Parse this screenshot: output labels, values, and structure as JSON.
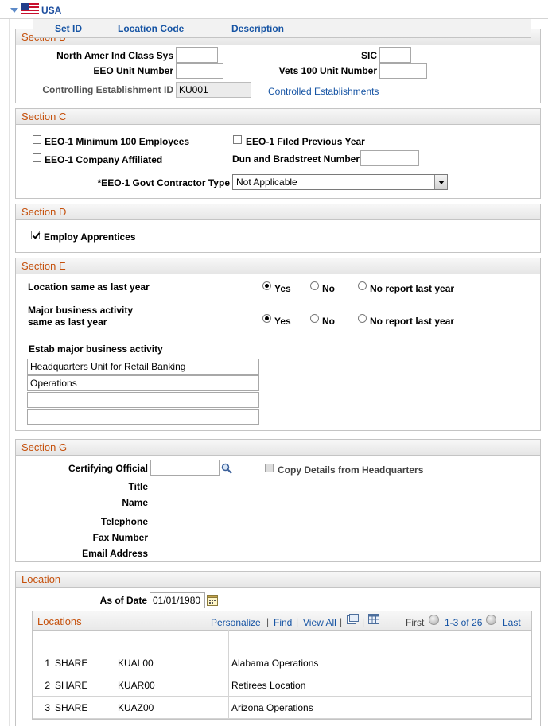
{
  "header": {
    "title": "USA"
  },
  "section_b": {
    "title": "Section B",
    "naics_label": "North Amer Ind Class Sys",
    "naics_value": "",
    "sic_label": "SIC",
    "sic_value": "",
    "eeo_unit_label": "EEO Unit Number",
    "eeo_unit_value": "",
    "vets_label": "Vets 100 Unit Number",
    "vets_value": "",
    "ctrl_label": "Controlling Establishment ID",
    "ctrl_value": "KU001",
    "ctrl_link": "Controlled Establishments"
  },
  "section_c": {
    "title": "Section C",
    "min100_label": "EEO-1 Minimum 100 Employees",
    "filed_label": "EEO-1 Filed Previous Year",
    "affiliated_label": "EEO-1 Company Affiliated",
    "duns_label": "Dun and Bradstreet Number",
    "duns_value": "",
    "contractor_label": "*EEO-1 Govt Contractor Type",
    "contractor_value": "Not Applicable"
  },
  "section_d": {
    "title": "Section D",
    "apprentices_label": "Employ Apprentices"
  },
  "section_e": {
    "title": "Section E",
    "loc_same_label": "Location same as last year",
    "major_label_1": "Major business activity",
    "major_label_2": "same as last year",
    "opt_yes": "Yes",
    "opt_no": "No",
    "opt_noreport": "No report last year",
    "estab_label": "Estab major business activity",
    "activity": [
      "Headquarters Unit for Retail Banking",
      "Operations",
      "",
      ""
    ]
  },
  "section_g": {
    "title": "Section G",
    "cert_label": "Certifying Official",
    "cert_value": "",
    "copy_label": "Copy Details from Headquarters",
    "title_label": "Title",
    "name_label": "Name",
    "phone_label": "Telephone",
    "fax_label": "Fax Number",
    "email_label": "Email Address"
  },
  "location": {
    "title": "Location",
    "asof_label": "As of Date",
    "asof_value": "01/01/1980",
    "grid_title": "Locations",
    "personalize": "Personalize",
    "find": "Find",
    "view_all": "View All",
    "first": "First",
    "range": "1-3 of 26",
    "last": "Last",
    "columns": [
      "Set ID",
      "Location Code",
      "Description"
    ],
    "rows": [
      {
        "num": "1",
        "setid": "SHARE",
        "code": "KUAL00",
        "desc": "Alabama Operations"
      },
      {
        "num": "2",
        "setid": "SHARE",
        "code": "KUAR00",
        "desc": "Retirees Location"
      },
      {
        "num": "3",
        "setid": "SHARE",
        "code": "KUAZ00",
        "desc": "Arizona Operations"
      }
    ]
  }
}
